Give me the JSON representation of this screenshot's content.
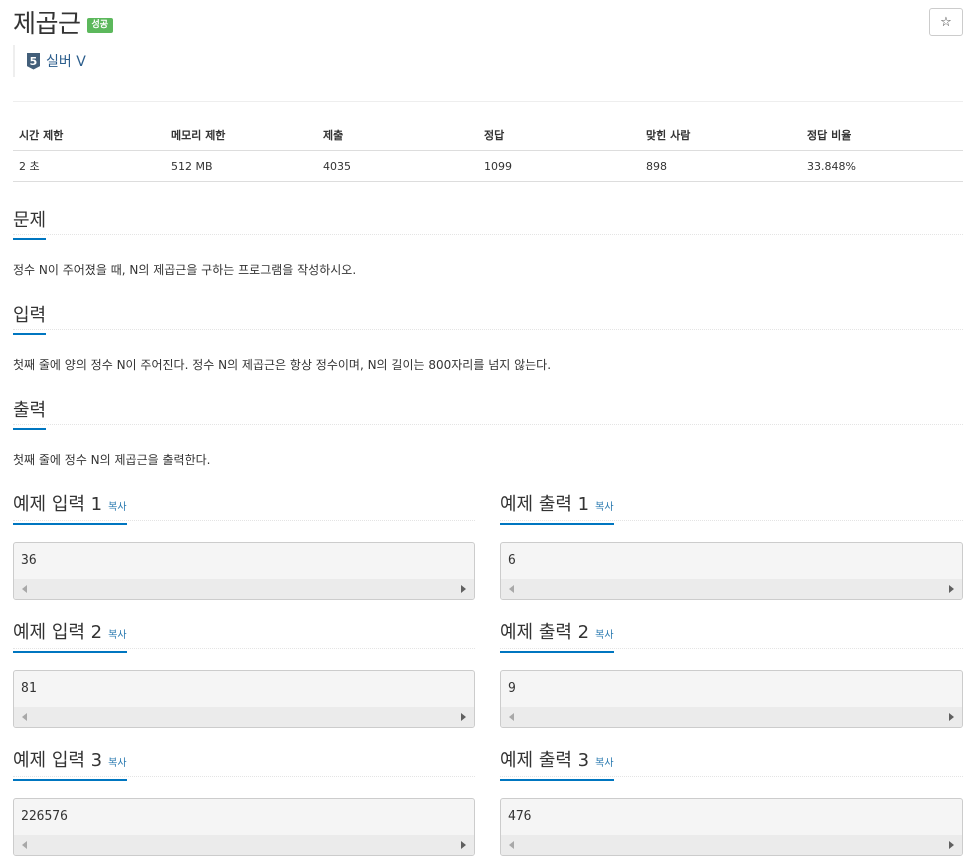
{
  "problem": {
    "title": "제곱근",
    "status_badge": "성공",
    "star_icon": "☆",
    "tier_number": "5",
    "tier_label": "실버 V",
    "tier_color": "#435f7a"
  },
  "info_table": {
    "headers": [
      "시간 제한",
      "메모리 제한",
      "제출",
      "정답",
      "맞힌 사람",
      "정답 비율"
    ],
    "values": [
      "2 초",
      "512 MB",
      "4035",
      "1099",
      "898",
      "33.848%"
    ]
  },
  "sections": {
    "description": {
      "heading": "문제",
      "body": "정수 N이 주어졌을 때, N의 제곱근을 구하는 프로그램을 작성하시오."
    },
    "input": {
      "heading": "입력",
      "body": "첫째 줄에 양의 정수 N이 주어진다. 정수 N의 제곱근은 항상 정수이며, N의 길이는 800자리를 넘지 않는다."
    },
    "output": {
      "heading": "출력",
      "body": "첫째 줄에 정수 N의 제곱근을 출력한다."
    }
  },
  "samples": [
    {
      "input_heading": "예제 입력 1",
      "input_value": "36",
      "output_heading": "예제 출력 1",
      "output_value": "6"
    },
    {
      "input_heading": "예제 입력 2",
      "input_value": "81",
      "output_heading": "예제 출력 2",
      "output_value": "9"
    },
    {
      "input_heading": "예제 입력 3",
      "input_value": "226576",
      "output_heading": "예제 출력 3",
      "output_value": "476"
    }
  ],
  "copy_label": "복사",
  "colors": {
    "accent": "#0076c0",
    "success": "#5cb85c",
    "link": "#2a7ab0"
  }
}
